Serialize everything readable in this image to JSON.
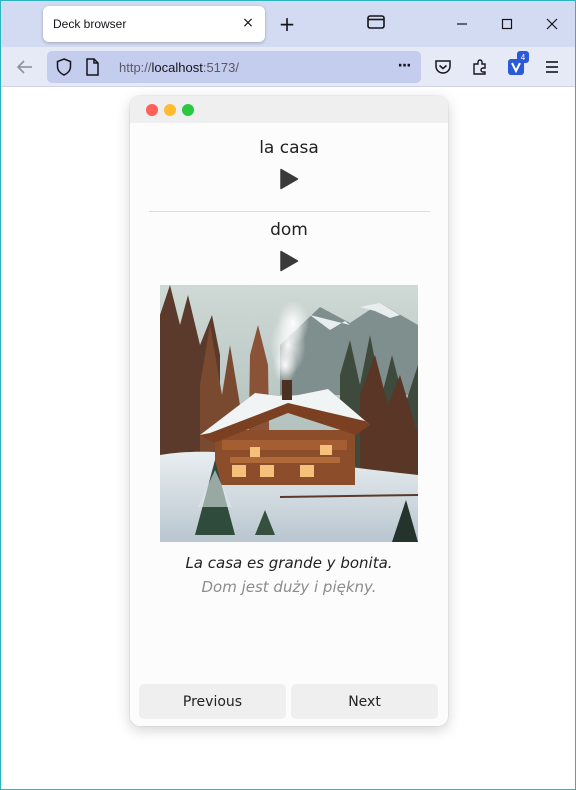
{
  "browser": {
    "tab_title": "Deck browser",
    "tab_close": "×",
    "new_tab": "+",
    "url_prefix": "http://",
    "url_host": "localhost",
    "url_rest": ":5173/",
    "page_actions": "···",
    "extension_badge": "4"
  },
  "card": {
    "front_word": "la casa",
    "back_word": "dom",
    "example_sentence": "La casa es grande y bonita.",
    "example_translation": "Dom jest duży i piękny.",
    "image_subject": "snowy-chalet-picture"
  },
  "navigation": {
    "previous_label": "Previous",
    "next_label": "Next"
  },
  "colors": {
    "accent_badge": "#2a5ad7",
    "traffic_red": "#fe5f57",
    "traffic_yellow": "#febc2e",
    "traffic_green": "#28c840"
  }
}
